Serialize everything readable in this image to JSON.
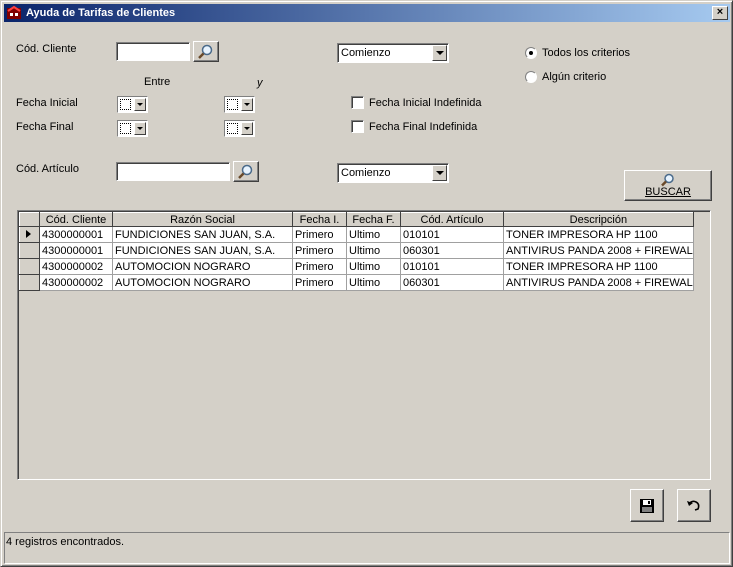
{
  "window": {
    "title": "Ayuda de Tarifas de Clientes",
    "close_label": "×"
  },
  "form": {
    "cod_cliente_label": "Cód. Cliente",
    "cod_cliente_value": "",
    "cod_cliente_match": "Comienzo",
    "entre_label": "Entre",
    "y_label": "y",
    "fecha_inicial_label": "Fecha Inicial",
    "fecha_final_label": "Fecha Final",
    "fecha_inicial_indef_label": "Fecha Inicial Indefinida",
    "fecha_final_indef_label": "Fecha Final Indefinida",
    "cod_articulo_label": "Cód. Artículo",
    "cod_articulo_value": "",
    "cod_articulo_match": "Comienzo",
    "radio_todos_label": "Todos los criterios",
    "radio_algun_label": "Algún criterio",
    "buscar_label": "BUSCAR"
  },
  "grid": {
    "columns": [
      "Cód. Cliente",
      "Razón Social",
      "Fecha I.",
      "Fecha F.",
      "Cód. Artículo",
      "Descripción"
    ],
    "rows": [
      [
        "4300000001",
        "FUNDICIONES SAN JUAN, S.A.",
        "Primero",
        "Ultimo",
        "010101",
        "TONER IMPRESORA HP 1100"
      ],
      [
        "4300000001",
        "FUNDICIONES SAN JUAN, S.A.",
        "Primero",
        "Ultimo",
        "060301",
        "ANTIVIRUS PANDA 2008 + FIREWAL"
      ],
      [
        "4300000002",
        "AUTOMOCION NOGRARO",
        "Primero",
        "Ultimo",
        "010101",
        "TONER IMPRESORA HP 1100"
      ],
      [
        "4300000002",
        "AUTOMOCION NOGRARO",
        "Primero",
        "Ultimo",
        "060301",
        "ANTIVIRUS PANDA 2008 + FIREWAL"
      ]
    ]
  },
  "status": {
    "text": "4 registros encontrados."
  },
  "icons": {
    "search": "magnifier-icon",
    "save": "floppy-disk-icon",
    "undo": "undo-arrow-icon"
  }
}
